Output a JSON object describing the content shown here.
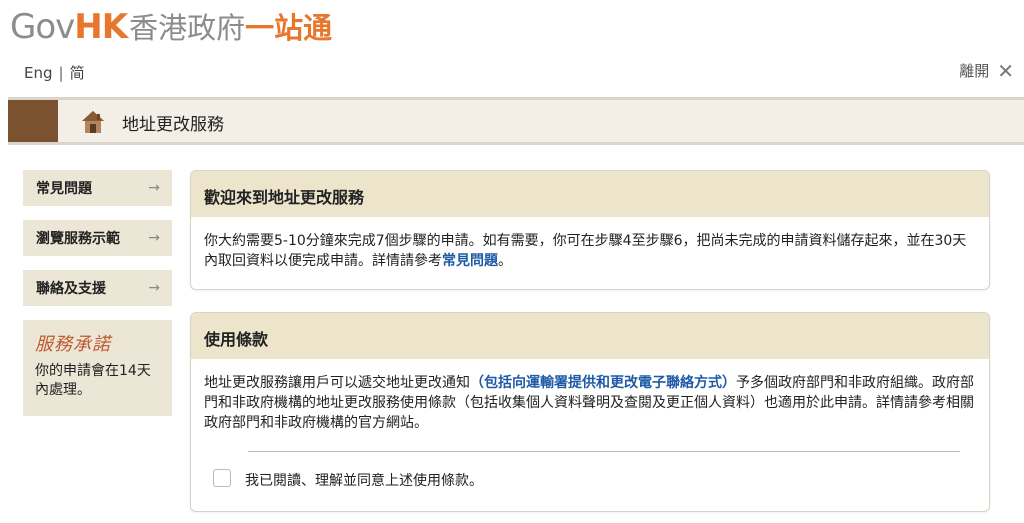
{
  "header": {
    "logo_gov": "Gov",
    "logo_hk": "HK",
    "logo_zh_grey": "香港政府",
    "logo_zh_orange": "一站通",
    "lang_en": "Eng",
    "lang_sep": "|",
    "lang_sc": "简",
    "exit_label": "離開",
    "exit_icon": "✕"
  },
  "page": {
    "title": "地址更改服務",
    "title_icon": "house-icon"
  },
  "sidebar": {
    "items": [
      {
        "label": "常見問題",
        "icon": "→"
      },
      {
        "label": "瀏覽服務示範",
        "icon": "→"
      },
      {
        "label": "聯絡及支援",
        "icon": "→"
      }
    ],
    "promise_brand": "服務承諾",
    "promise_text": "你的申請會在14天內處理。"
  },
  "welcome": {
    "heading": "歡迎來到地址更改服務",
    "body_1": "你大約需要5-10分鐘來完成7個步驟的申請。如有需要，你可在步驟4至步驟6，把尚未完成的申請資料儲存起來，並在30天內取回資料以便完成申請。詳情請參考",
    "link": "常見問題",
    "body_2": "。"
  },
  "terms": {
    "heading": "使用條款",
    "body_1": "地址更改服務讓用戶可以遞交地址更改通知",
    "link": "（包括向運輸署提供和更改電子聯絡方式）",
    "body_2": "予多個政府部門和非政府組織。政府部門和非政府機構的地址更改服務使用條款（包括收集個人資料聲明及查閱及更正個人資料）也適用於此申請。詳情請參考相關政府部門和非政府機構的官方網站。",
    "checkbox_label": "我已閱讀、理解並同意上述使用條款。"
  },
  "colors": {
    "brand_orange": "#e8772e",
    "header_brown": "#7a5230",
    "panel_header": "#ece5cc",
    "link_blue": "#1f5aa6"
  }
}
